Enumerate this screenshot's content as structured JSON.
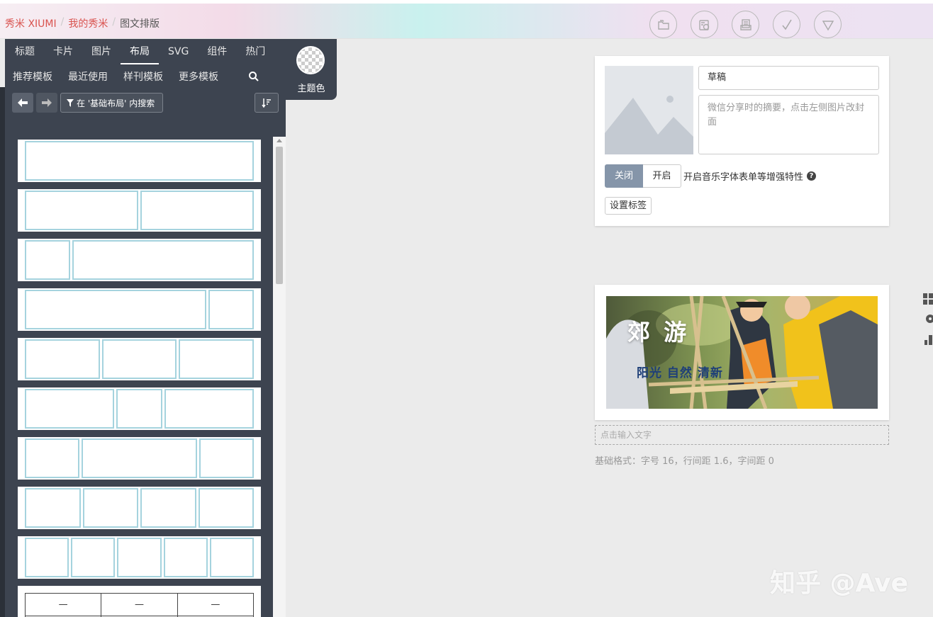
{
  "breadcrumb": {
    "home": "秀米 XIUMI",
    "mine": "我的秀米",
    "current": "图文排版",
    "sep": "/"
  },
  "toolbar": {
    "icons": [
      "folder-icon",
      "camera-icon",
      "print-icon",
      "check-icon",
      "triangle-down-icon"
    ]
  },
  "panel": {
    "tabs": [
      "标题",
      "卡片",
      "图片",
      "布局",
      "SVG",
      "组件",
      "热门"
    ],
    "active_tab": "布局",
    "subtabs": [
      "推荐模板",
      "最近使用",
      "样刊模板",
      "更多模板"
    ],
    "filter_label": "在 '基础布局' 内搜索",
    "theme_label": "主题色",
    "table_cells": [
      "—",
      "—",
      "—"
    ]
  },
  "article": {
    "title": "草稿",
    "summary_placeholder": "微信分享时的摘要，点击左侧图片改封面",
    "toggle_off": "关闭",
    "toggle_on": "开启",
    "toggle_label": "开启音乐字体表单等增强特性",
    "help": "?",
    "tag_button": "设置标签"
  },
  "image": {
    "title": "郊 游",
    "subtitle": "阳光 自然 清新"
  },
  "editor": {
    "input_hint": "点击输入文字",
    "format_info": "基础格式：字号 16，行间距 1.6，字间距 0"
  },
  "watermark": "知乎 @Ave",
  "colors": {
    "breadcrumb_link": "#d9534f",
    "panel_bg": "#3d4450",
    "cell_border": "#a5d3de",
    "toggle_active": "#8595a9"
  }
}
